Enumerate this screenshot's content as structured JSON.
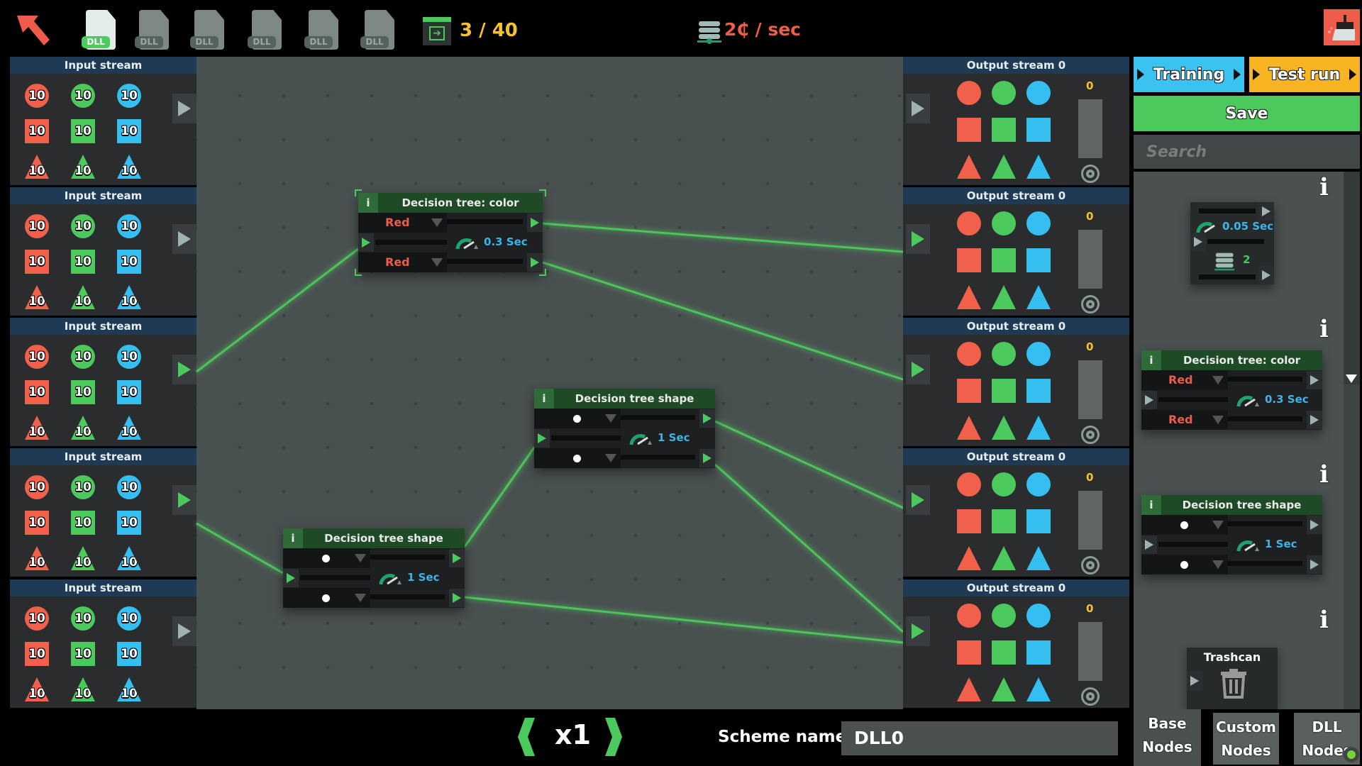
{
  "topbar": {
    "back_icon": "back-arrow-icon",
    "dll_slots": [
      {
        "label": "DLL",
        "active": true
      },
      {
        "label": "DLL",
        "active": false
      },
      {
        "label": "DLL",
        "active": false
      },
      {
        "label": "DLL",
        "active": false
      },
      {
        "label": "DLL",
        "active": false
      },
      {
        "label": "DLL",
        "active": false
      }
    ],
    "level_counter": "3 / 40",
    "rate": "2₵ / sec",
    "clear_icon": "broom-icon"
  },
  "colors": {
    "red": "#f0604a",
    "green": "#4cc95c",
    "blue": "#35bff0",
    "header": "#1f3a55",
    "node_header": "#1e4a26"
  },
  "input_streams": [
    {
      "title": "Input stream",
      "counts": [
        [
          "10",
          "10",
          "10"
        ],
        [
          "10",
          "10",
          "10"
        ],
        [
          "10",
          "10",
          "10"
        ]
      ]
    },
    {
      "title": "Input stream",
      "counts": [
        [
          "10",
          "10",
          "10"
        ],
        [
          "10",
          "10",
          "10"
        ],
        [
          "10",
          "10",
          "10"
        ]
      ]
    },
    {
      "title": "Input stream",
      "counts": [
        [
          "10",
          "10",
          "10"
        ],
        [
          "10",
          "10",
          "10"
        ],
        [
          "10",
          "10",
          "10"
        ]
      ],
      "connected": true
    },
    {
      "title": "Input stream",
      "counts": [
        [
          "10",
          "10",
          "10"
        ],
        [
          "10",
          "10",
          "10"
        ],
        [
          "10",
          "10",
          "10"
        ]
      ],
      "connected": true
    },
    {
      "title": "Input stream",
      "counts": [
        [
          "10",
          "10",
          "10"
        ],
        [
          "10",
          "10",
          "10"
        ],
        [
          "10",
          "10",
          "10"
        ]
      ]
    }
  ],
  "output_streams": [
    {
      "title": "Output stream 0",
      "count": "0"
    },
    {
      "title": "Output stream 0",
      "count": "0",
      "connected": true
    },
    {
      "title": "Output stream 0",
      "count": "0",
      "connected": true
    },
    {
      "title": "Output stream 0",
      "count": "0",
      "connected": true
    },
    {
      "title": "Output stream 0",
      "count": "0",
      "connected": true
    }
  ],
  "canvas_nodes": [
    {
      "title": "Decision tree: color",
      "info": "i",
      "top_value": "Red",
      "bottom_value": "Red",
      "time": "0.3 Sec",
      "selected": true
    },
    {
      "title": "Decision tree shape",
      "info": "i",
      "top_value_icon": "circle",
      "bottom_value_icon": "circle",
      "time": "1 Sec"
    },
    {
      "title": "Decision tree shape",
      "info": "i",
      "top_value_icon": "circle",
      "bottom_value_icon": "circle",
      "time": "1 Sec"
    }
  ],
  "sidebar": {
    "training_label": "Training",
    "test_run_label": "Test run",
    "save_label": "Save",
    "search_placeholder": "Search",
    "info_label": "i",
    "library": {
      "delay_node": {
        "time": "0.05 Sec",
        "count": "2"
      },
      "color_node": {
        "title": "Decision tree: color",
        "info": "i",
        "top_value": "Red",
        "bottom_value": "Red",
        "time": "0.3 Sec"
      },
      "shape_node": {
        "title": "Decision tree shape",
        "info": "i",
        "time": "1 Sec"
      },
      "trashcan": {
        "title": "Trashcan"
      }
    },
    "tabs": [
      {
        "line1": "Base",
        "line2": "Nodes",
        "active": true
      },
      {
        "line1": "Custom",
        "line2": "Nodes",
        "active": false
      },
      {
        "line1": "DLL",
        "line2": "Nodes",
        "active": false,
        "status_dot": "#7bd13a"
      }
    ]
  },
  "bottom": {
    "speed": "x1",
    "scheme_label": "Scheme name :",
    "scheme_name": "DLL0"
  }
}
